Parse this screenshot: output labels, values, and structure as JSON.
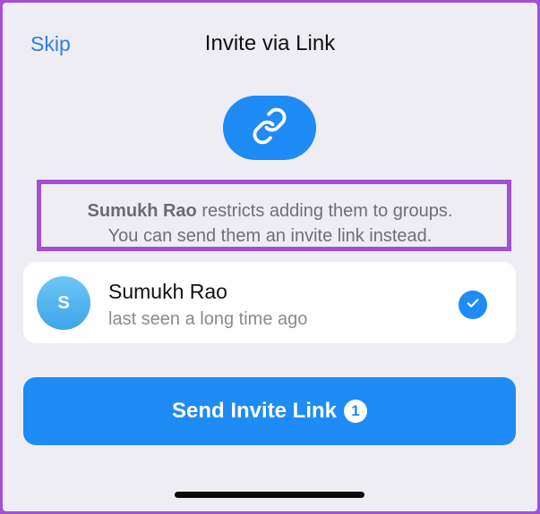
{
  "header": {
    "skip_label": "Skip",
    "title": "Invite via Link"
  },
  "icons": {
    "link": "link-icon",
    "check": "checkmark-icon"
  },
  "notice": {
    "name": "Sumukh Rao",
    "line1_rest": " restricts adding them to groups.",
    "line2": "You can send them an invite link instead."
  },
  "contact": {
    "initial": "S",
    "name": "Sumukh Rao",
    "status": "last seen a long time ago",
    "selected": true
  },
  "action": {
    "send_label": "Send Invite Link",
    "count": "1"
  },
  "colors": {
    "accent": "#1f8bf5",
    "highlight_border": "#a24fd6",
    "background": "#eeedf3"
  }
}
